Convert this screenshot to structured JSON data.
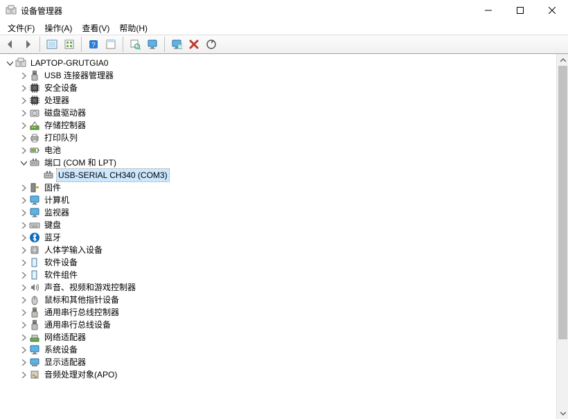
{
  "window": {
    "title": "设备管理器"
  },
  "menu": {
    "file": "文件(F)",
    "action": "操作(A)",
    "view": "查看(V)",
    "help": "帮助(H)"
  },
  "root": {
    "label": "LAPTOP-GRUTGIA0"
  },
  "categories": [
    {
      "icon": "usb",
      "label": "USB 连接器管理器"
    },
    {
      "icon": "chip",
      "label": "安全设备"
    },
    {
      "icon": "cpu",
      "label": "处理器"
    },
    {
      "icon": "disk",
      "label": "磁盘驱动器"
    },
    {
      "icon": "storage",
      "label": "存储控制器"
    },
    {
      "icon": "printer",
      "label": "打印队列"
    },
    {
      "icon": "battery",
      "label": "电池"
    },
    {
      "icon": "port",
      "label": "端口 (COM 和 LPT)",
      "expanded": true,
      "children": [
        {
          "icon": "port",
          "label": "USB-SERIAL CH340 (COM3)",
          "selected": true
        }
      ]
    },
    {
      "icon": "firmware",
      "label": "固件"
    },
    {
      "icon": "monitor",
      "label": "计算机"
    },
    {
      "icon": "monitor",
      "label": "监视器"
    },
    {
      "icon": "keyboard",
      "label": "键盘"
    },
    {
      "icon": "bluetooth",
      "label": "蓝牙"
    },
    {
      "icon": "hid",
      "label": "人体学输入设备"
    },
    {
      "icon": "soft",
      "label": "软件设备"
    },
    {
      "icon": "soft",
      "label": "软件组件"
    },
    {
      "icon": "sound",
      "label": "声音、视频和游戏控制器"
    },
    {
      "icon": "mouse",
      "label": "鼠标和其他指针设备"
    },
    {
      "icon": "usbctl",
      "label": "通用串行总线控制器"
    },
    {
      "icon": "usbctl",
      "label": "通用串行总线设备"
    },
    {
      "icon": "net",
      "label": "网络适配器"
    },
    {
      "icon": "system",
      "label": "系统设备"
    },
    {
      "icon": "display",
      "label": "显示适配器"
    },
    {
      "icon": "apo",
      "label": "音频处理对象(APO)"
    }
  ]
}
